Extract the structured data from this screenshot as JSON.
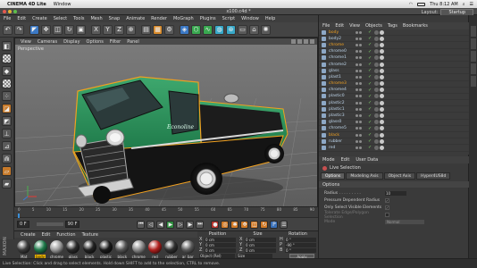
{
  "mac": {
    "apple": "",
    "menus": [
      "CINEMA 4D Lite",
      "Window"
    ],
    "right": {
      "wifi": "◠",
      "battery": "",
      "time": "Thu 8:12 AM",
      "search": "⌕",
      "list": "☰"
    }
  },
  "window": {
    "title": "x100.c4d *",
    "layout_label": "Layout:",
    "layout_value": "Startup"
  },
  "menubar": [
    "File",
    "Edit",
    "Create",
    "Select",
    "Tools",
    "Mesh",
    "Snap",
    "Animate",
    "Render",
    "MoGraph",
    "Plugins",
    "Script",
    "Window",
    "Help"
  ],
  "viewport": {
    "menu": [
      "View",
      "Cameras",
      "Display",
      "Options",
      "Filter",
      "Panel"
    ],
    "label": "Perspective",
    "car_script": "Econoline"
  },
  "timeline": {
    "ticks": [
      "0",
      "5",
      "10",
      "15",
      "20",
      "25",
      "30",
      "35",
      "40",
      "45",
      "50",
      "55",
      "60",
      "65",
      "70",
      "75",
      "80",
      "85",
      "90"
    ],
    "start_field": "0 F",
    "end_field": "90 F",
    "current_field": "0 F"
  },
  "materials": {
    "menu": [
      "Create",
      "Edit",
      "Function",
      "Texture"
    ],
    "items": [
      {
        "label": "Mat",
        "color": "#3a3a3a",
        "selected": false
      },
      {
        "label": "body",
        "color": "#1f7a4a",
        "selected": true
      },
      {
        "label": "chrome",
        "color": "#9a9a9a",
        "selected": false
      },
      {
        "label": "glass",
        "color": "#2a2a2a",
        "selected": false
      },
      {
        "label": "black",
        "color": "#222222",
        "selected": false
      },
      {
        "label": "plastic",
        "color": "#1a1a1a",
        "selected": false
      },
      {
        "label": "black",
        "color": "#555555",
        "selected": false
      },
      {
        "label": "chrome",
        "color": "#8a8a8a",
        "selected": false
      },
      {
        "label": "red",
        "color": "#b0201e",
        "selected": false
      },
      {
        "label": "rubber",
        "color": "#2f2f2f",
        "selected": false
      },
      {
        "label": "ar_bar",
        "color": "#5a5a5a",
        "selected": false
      }
    ]
  },
  "coords": {
    "headers": [
      "Position",
      "Size",
      "Rotation"
    ],
    "rows": [
      {
        "a": "X",
        "av": "0 cm",
        "b": "X",
        "bv": "0 cm",
        "c": "H",
        "cv": "0 °"
      },
      {
        "a": "Y",
        "av": "0 cm",
        "b": "Y",
        "bv": "0 cm",
        "c": "P",
        "cv": "-90 °"
      },
      {
        "a": "Z",
        "av": "0 cm",
        "b": "Z",
        "bv": "0 cm",
        "c": "B",
        "cv": "0 °"
      }
    ],
    "mode": "Object (Rel)",
    "size_mode": "Size",
    "apply": "Apply"
  },
  "objects": {
    "menu": [
      "File",
      "Edit",
      "View",
      "Objects",
      "Tags",
      "Bookmarks"
    ],
    "rows": [
      {
        "name": "body",
        "hl": true
      },
      {
        "name": "body2",
        "hl": false
      },
      {
        "name": "chrome",
        "hl": true
      },
      {
        "name": "chrome0",
        "hl": false
      },
      {
        "name": "chrome1",
        "hl": false
      },
      {
        "name": "chrome2",
        "hl": false
      },
      {
        "name": "glass",
        "hl": false
      },
      {
        "name": "plast1",
        "hl": false
      },
      {
        "name": "chrome3",
        "hl": true
      },
      {
        "name": "chrome4",
        "hl": false
      },
      {
        "name": "plastic0",
        "hl": false
      },
      {
        "name": "plastic2",
        "hl": false
      },
      {
        "name": "plastic1",
        "hl": false
      },
      {
        "name": "plastic3",
        "hl": false
      },
      {
        "name": "glass0",
        "hl": false
      },
      {
        "name": "chrome5",
        "hl": false
      },
      {
        "name": "black",
        "hl": true
      },
      {
        "name": "rubber",
        "hl": false
      },
      {
        "name": "red",
        "hl": false
      }
    ]
  },
  "attributes": {
    "menu": [
      "Mode",
      "Edit",
      "User Data"
    ],
    "title": "Live Selection",
    "tabs": [
      "Options",
      "Modeling Axis",
      "Object Axis",
      "Hyper4US8d"
    ],
    "active_tab": "Options",
    "section": "Options",
    "props": [
      {
        "label": "Radius . . . . . . . . .",
        "value": "10"
      },
      {
        "label": "Pressure Dependent Radius",
        "value": "✓"
      },
      {
        "label": "Only Select Visible Elements",
        "value": "✓"
      },
      {
        "label": "Tolerate Edge/Polygon Selection",
        "value": ""
      },
      {
        "label": "Mode",
        "value": "Normal"
      }
    ]
  },
  "status": "Live Selection: Click and drag to select elements. Hold down SHIFT to add to the selection, CTRL to remove.",
  "logo": "MAXON",
  "colors": {
    "car_body": "#1f7a4a",
    "outline": "#f0a020",
    "highlight_orange": "#e8b100"
  }
}
